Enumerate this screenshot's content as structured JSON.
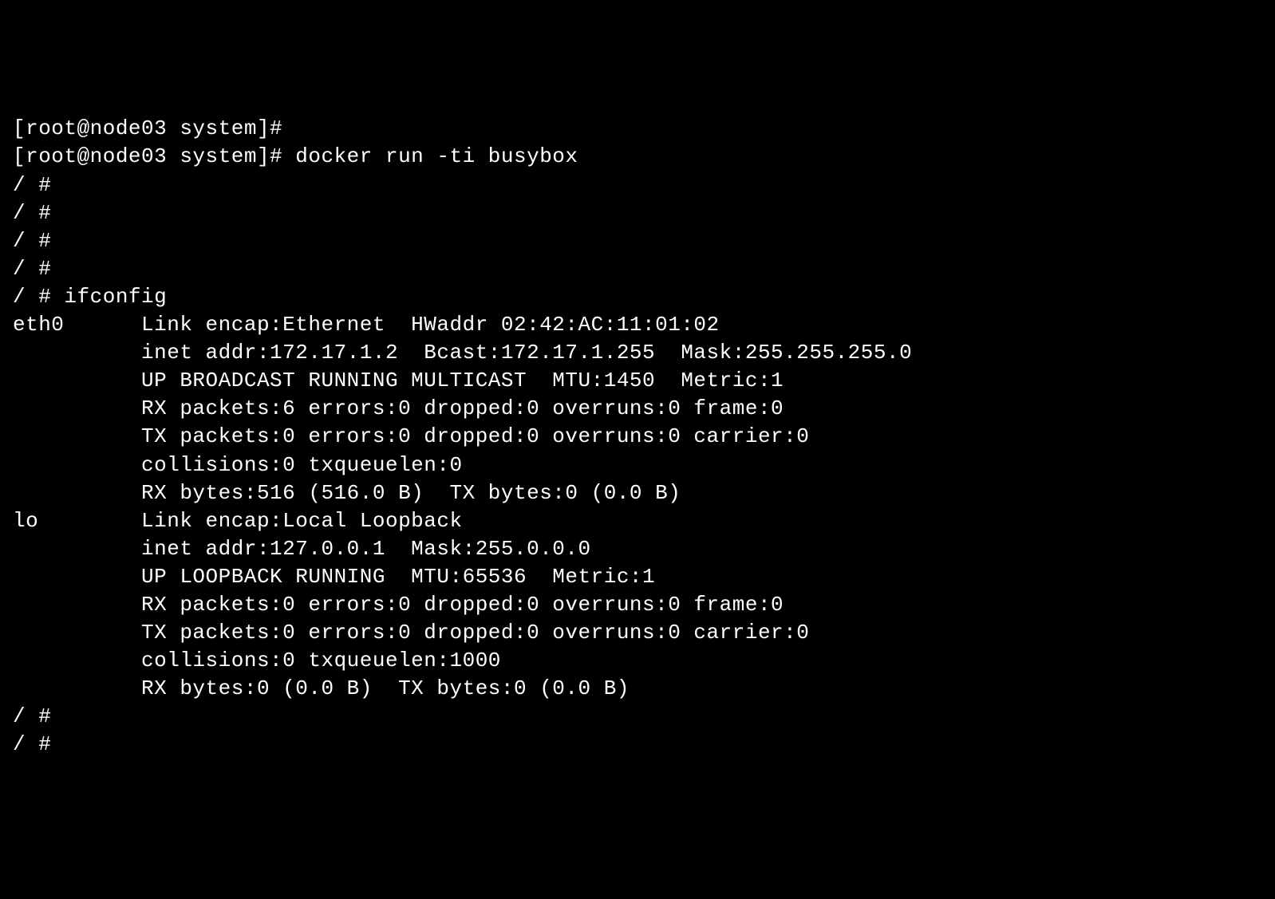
{
  "terminal": {
    "lines": [
      "[root@node03 system]#",
      "[root@node03 system]# docker run -ti busybox",
      "/ #",
      "/ #",
      "/ #",
      "/ #",
      "/ # ifconfig",
      "eth0      Link encap:Ethernet  HWaddr 02:42:AC:11:01:02",
      "          inet addr:172.17.1.2  Bcast:172.17.1.255  Mask:255.255.255.0",
      "          UP BROADCAST RUNNING MULTICAST  MTU:1450  Metric:1",
      "          RX packets:6 errors:0 dropped:0 overruns:0 frame:0",
      "          TX packets:0 errors:0 dropped:0 overruns:0 carrier:0",
      "          collisions:0 txqueuelen:0",
      "          RX bytes:516 (516.0 B)  TX bytes:0 (0.0 B)",
      "",
      "lo        Link encap:Local Loopback",
      "          inet addr:127.0.0.1  Mask:255.0.0.0",
      "          UP LOOPBACK RUNNING  MTU:65536  Metric:1",
      "          RX packets:0 errors:0 dropped:0 overruns:0 frame:0",
      "          TX packets:0 errors:0 dropped:0 overruns:0 carrier:0",
      "          collisions:0 txqueuelen:1000",
      "          RX bytes:0 (0.0 B)  TX bytes:0 (0.0 B)",
      "",
      "/ #",
      "/ #"
    ]
  },
  "session": {
    "host_prompt": "[root@node03 system]#",
    "container_prompt": "/ #",
    "command_docker": "docker run -ti busybox",
    "command_ifconfig": "ifconfig"
  },
  "interfaces": {
    "eth0": {
      "name": "eth0",
      "link_encap": "Ethernet",
      "hwaddr": "02:42:AC:11:01:02",
      "inet_addr": "172.17.1.2",
      "bcast": "172.17.1.255",
      "mask": "255.255.255.0",
      "flags": "UP BROADCAST RUNNING MULTICAST",
      "mtu": 1450,
      "metric": 1,
      "rx_packets": 6,
      "rx_errors": 0,
      "rx_dropped": 0,
      "rx_overruns": 0,
      "rx_frame": 0,
      "tx_packets": 0,
      "tx_errors": 0,
      "tx_dropped": 0,
      "tx_overruns": 0,
      "tx_carrier": 0,
      "collisions": 0,
      "txqueuelen": 0,
      "rx_bytes": 516,
      "rx_bytes_human": "516.0 B",
      "tx_bytes": 0,
      "tx_bytes_human": "0.0 B"
    },
    "lo": {
      "name": "lo",
      "link_encap": "Local Loopback",
      "inet_addr": "127.0.0.1",
      "mask": "255.0.0.0",
      "flags": "UP LOOPBACK RUNNING",
      "mtu": 65536,
      "metric": 1,
      "rx_packets": 0,
      "rx_errors": 0,
      "rx_dropped": 0,
      "rx_overruns": 0,
      "rx_frame": 0,
      "tx_packets": 0,
      "tx_errors": 0,
      "tx_dropped": 0,
      "tx_overruns": 0,
      "tx_carrier": 0,
      "collisions": 0,
      "txqueuelen": 1000,
      "rx_bytes": 0,
      "rx_bytes_human": "0.0 B",
      "tx_bytes": 0,
      "tx_bytes_human": "0.0 B"
    }
  }
}
